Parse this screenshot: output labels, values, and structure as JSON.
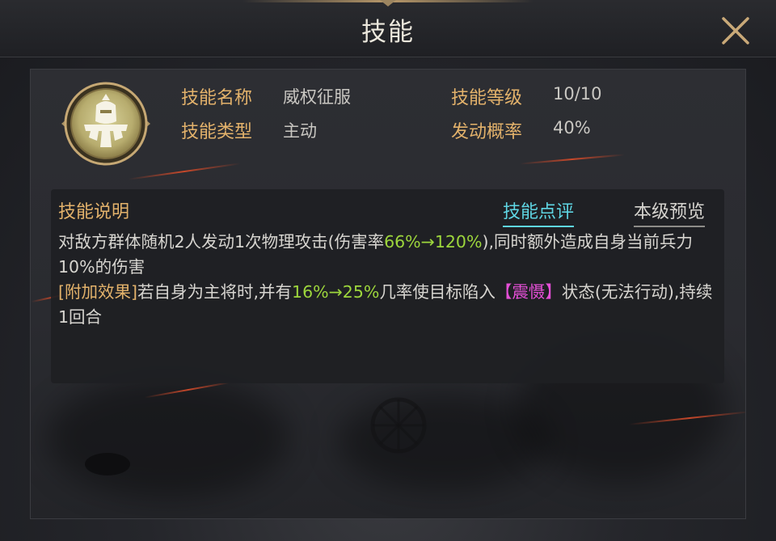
{
  "header": {
    "title": "技能",
    "close_icon": "close-icon"
  },
  "skill": {
    "icon": "warrior-helmet-icon",
    "name_label": "技能名称",
    "name_value": "威权征服",
    "type_label": "技能类型",
    "type_value": "主动",
    "level_label": "技能等级",
    "level_value": "10/10",
    "chance_label": "发动概率",
    "chance_value": "40%"
  },
  "description": {
    "title": "技能说明",
    "tab_review": "技能点评",
    "tab_preview": "本级预览",
    "line1_text_a": "对敌方群体随机2人发动1次物理攻击(伤害率",
    "line1_highlight": "66%→120%",
    "line1_text_b": "),同时额外造成自身当前兵力10%的伤害",
    "extra_label": "[附加效果]",
    "extra_text_a": "若自身为主将时,并有",
    "extra_highlight": "16%→25%",
    "extra_text_b": "几率使目标陷入",
    "status_name": "【震慑】",
    "extra_text_c": "状态(无法行动),持续1回合"
  },
  "colors": {
    "label_gold": "#e3b26b",
    "highlight_green": "#9dd63c",
    "status_magenta": "#e54fd7",
    "tab_active_cyan": "#5fd6e4"
  }
}
